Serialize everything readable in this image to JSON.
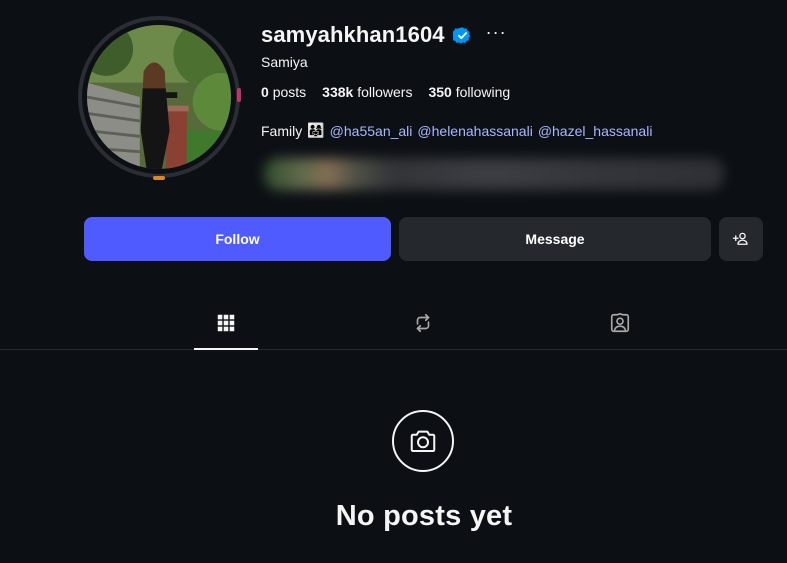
{
  "profile": {
    "username": "samyahkhan1604",
    "full_name": "Samiya",
    "verified_icon": "verified-badge-icon",
    "more_label": "···",
    "stats": {
      "posts_count": "0",
      "posts_label": "posts",
      "followers_count": "338k",
      "followers_label": "followers",
      "following_count": "350",
      "following_label": "following"
    },
    "bio": {
      "text": "Family",
      "emoji": "👨‍👩‍👧",
      "mentions": [
        "@ha55an_ali",
        "@helenahassanali",
        "@hazel_hassanali"
      ]
    }
  },
  "actions": {
    "follow_label": "Follow",
    "message_label": "Message",
    "add_user_icon": "add-person-icon"
  },
  "tabs": [
    {
      "icon": "grid-icon",
      "active": true
    },
    {
      "icon": "repost-icon",
      "active": false
    },
    {
      "icon": "tagged-icon",
      "active": false
    }
  ],
  "empty_state": {
    "icon": "camera-icon",
    "title": "No posts yet"
  },
  "colors": {
    "background": "#0c1014",
    "accent": "#4f5bff",
    "secondary_button": "#25292e",
    "mention": "#a8b8ff",
    "verified": "#0095f6"
  }
}
